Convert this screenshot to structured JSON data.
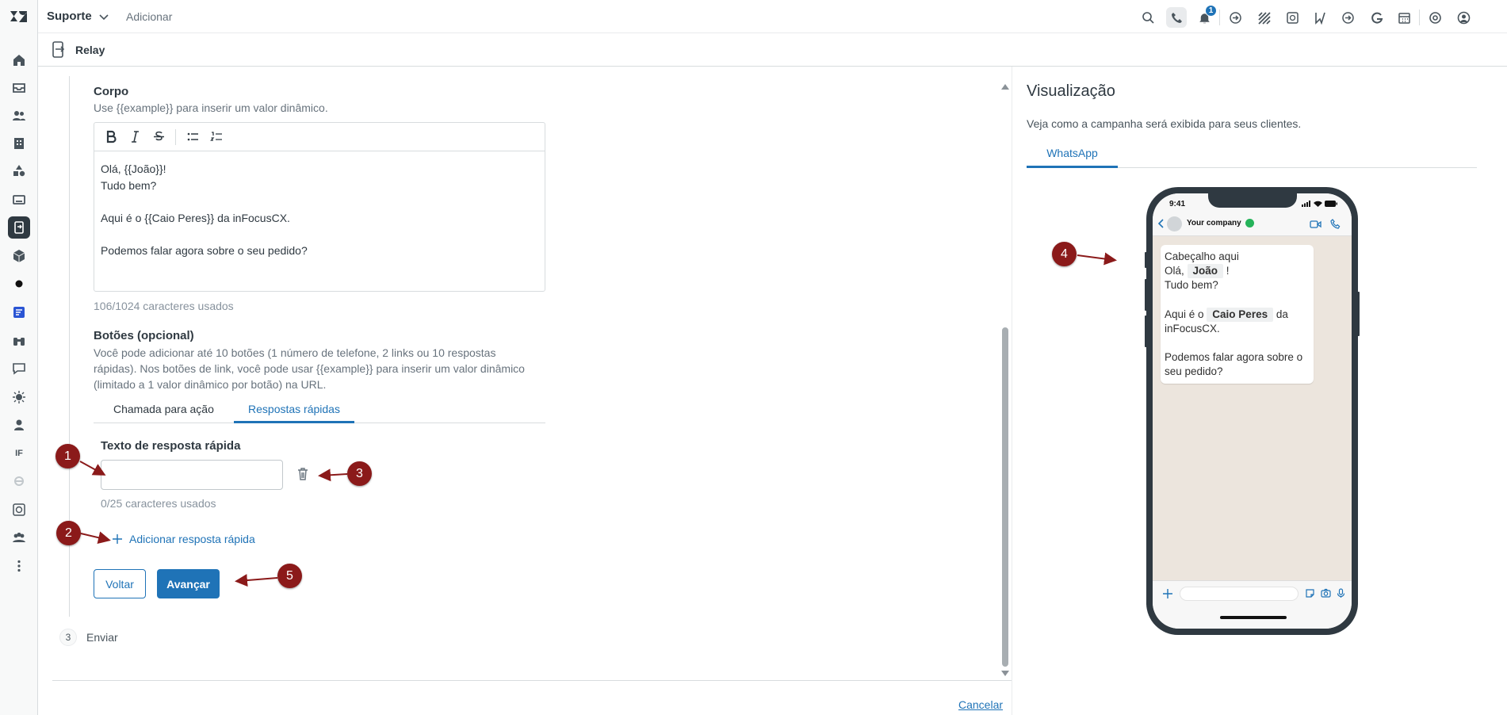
{
  "topbar": {
    "product_label": "Suporte",
    "add_label": "Adicionar",
    "notification_count": "1"
  },
  "subheader": {
    "app_title": "Relay"
  },
  "rail": {
    "if_label": "IF"
  },
  "form": {
    "body_label": "Corpo",
    "body_hint": "Use {{example}} para inserir um valor dinâmico.",
    "body_lines": [
      "Olá, {{João}}!",
      "Tudo bem?",
      "",
      "Aqui é o {{Caio Peres}} da inFocusCX.",
      "",
      "Podemos falar agora sobre o seu pedido?"
    ],
    "body_counter": "106/1024 caracteres usados",
    "buttons_label": "Botões (opcional)",
    "buttons_hint_lines": [
      "Você pode adicionar até 10 botões (1 número de telefone, 2 links ou 10 respostas",
      "rápidas). Nos botões de link, você pode usar {{example}} para inserir um valor dinâmico",
      "(limitado a 1 valor dinâmico por botão) na URL."
    ],
    "tabs": [
      {
        "label": "Chamada para ação",
        "selected": false
      },
      {
        "label": "Respostas rápidas",
        "selected": true
      }
    ],
    "quick_reply_label": "Texto de resposta rápida",
    "quick_reply_value": "",
    "quick_reply_counter": "0/25 caracteres usados",
    "add_quick_reply_label": "Adicionar resposta rápida",
    "back_label": "Voltar",
    "next_label": "Avançar",
    "step3_number": "3",
    "step3_label": "Enviar",
    "cancel_label": "Cancelar"
  },
  "preview": {
    "title": "Visualização",
    "subtitle": "Veja como a campanha será exibida para seus clientes.",
    "tab_label": "WhatsApp",
    "phone_time": "9:41",
    "company_name": "Your company",
    "message": {
      "header": "Cabeçalho aqui",
      "greeting_prefix": "Olá, ",
      "greeting_var": "João",
      "greeting_suffix": " !",
      "line2": "Tudo bem?",
      "intro_prefix": "Aqui é o ",
      "intro_var": "Caio Peres",
      "intro_suffix": " da",
      "intro_line2": "inFocusCX.",
      "question_line1": "Podemos falar agora sobre o",
      "question_line2": "seu pedido?"
    }
  },
  "annotations": [
    "1",
    "2",
    "3",
    "4",
    "5"
  ],
  "colors": {
    "accent": "#1f73b7",
    "marker": "#8b1a1a",
    "rail_bg": "#f8f9f9",
    "chat_bg": "#ece5dd",
    "verified": "#25b35a"
  }
}
